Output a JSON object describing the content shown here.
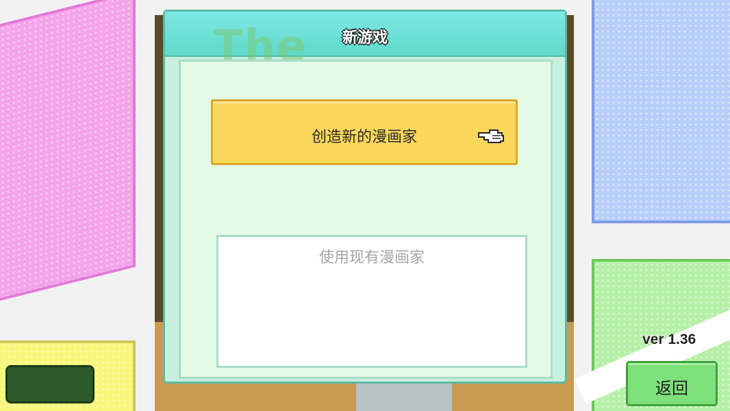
{
  "dialog": {
    "title": "新游戏",
    "create_button_label": "创造新的漫画家",
    "existing_label": "使用现有漫画家"
  },
  "background": {
    "watermark_text": "The"
  },
  "footer": {
    "version": "ver 1.36",
    "back_label": "返回"
  },
  "icons": {
    "pointer": "pointing-hand-icon"
  },
  "colors": {
    "header": "#5fd9c9",
    "create_button": "#fbd75c",
    "back_button": "#7ee07a"
  }
}
